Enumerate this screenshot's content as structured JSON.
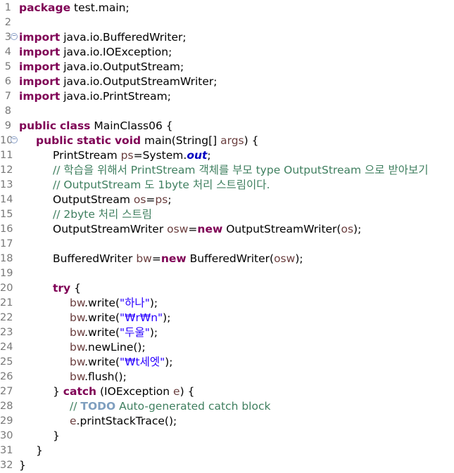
{
  "editor": {
    "language": "java",
    "lines": [
      {
        "n": "1",
        "indent": 0,
        "tokens": [
          {
            "t": "package",
            "c": "kw"
          },
          {
            "t": " test.main;"
          }
        ]
      },
      {
        "n": "2",
        "indent": 0,
        "tokens": []
      },
      {
        "n": "3",
        "indent": 0,
        "fold": true,
        "tokens": [
          {
            "t": "import",
            "c": "kw"
          },
          {
            "t": " java.io.BufferedWriter;"
          }
        ]
      },
      {
        "n": "4",
        "indent": 0,
        "tokens": [
          {
            "t": "import",
            "c": "kw"
          },
          {
            "t": " java.io.IOException;"
          }
        ]
      },
      {
        "n": "5",
        "indent": 0,
        "tokens": [
          {
            "t": "import",
            "c": "kw"
          },
          {
            "t": " java.io.OutputStream;"
          }
        ]
      },
      {
        "n": "6",
        "indent": 0,
        "tokens": [
          {
            "t": "import",
            "c": "kw"
          },
          {
            "t": " java.io.OutputStreamWriter;"
          }
        ]
      },
      {
        "n": "7",
        "indent": 0,
        "tokens": [
          {
            "t": "import",
            "c": "kw"
          },
          {
            "t": " java.io.PrintStream;"
          }
        ]
      },
      {
        "n": "8",
        "indent": 0,
        "tokens": []
      },
      {
        "n": "9",
        "indent": 0,
        "tokens": [
          {
            "t": "public",
            "c": "kw"
          },
          {
            "t": " "
          },
          {
            "t": "class",
            "c": "kw"
          },
          {
            "t": " MainClass06 {"
          }
        ]
      },
      {
        "n": "10",
        "indent": 1,
        "fold": true,
        "tokens": [
          {
            "t": "public",
            "c": "kw"
          },
          {
            "t": " "
          },
          {
            "t": "static",
            "c": "kw"
          },
          {
            "t": " "
          },
          {
            "t": "void",
            "c": "kw"
          },
          {
            "t": " main(String[] "
          },
          {
            "t": "args",
            "c": "var"
          },
          {
            "t": ") {"
          }
        ]
      },
      {
        "n": "11",
        "indent": 2,
        "tokens": [
          {
            "t": "PrintStream "
          },
          {
            "t": "ps",
            "c": "var"
          },
          {
            "t": "=System."
          },
          {
            "t": "out",
            "c": "sf"
          },
          {
            "t": ";"
          }
        ]
      },
      {
        "n": "12",
        "indent": 2,
        "tokens": [
          {
            "t": "// 학습을 위해서 PrintStream 객체를 부모 type OutputStream 으로 받아보기",
            "c": "cm"
          }
        ]
      },
      {
        "n": "13",
        "indent": 2,
        "tokens": [
          {
            "t": "// OutputStream 도 1byte 처리 스트림이다.",
            "c": "cm"
          }
        ]
      },
      {
        "n": "14",
        "indent": 2,
        "tokens": [
          {
            "t": "OutputStream "
          },
          {
            "t": "os",
            "c": "var"
          },
          {
            "t": "="
          },
          {
            "t": "ps",
            "c": "var"
          },
          {
            "t": ";"
          }
        ]
      },
      {
        "n": "15",
        "indent": 2,
        "tokens": [
          {
            "t": "// 2byte 처리 스트림",
            "c": "cm"
          }
        ]
      },
      {
        "n": "16",
        "indent": 2,
        "tokens": [
          {
            "t": "OutputStreamWriter "
          },
          {
            "t": "osw",
            "c": "var"
          },
          {
            "t": "="
          },
          {
            "t": "new",
            "c": "kw"
          },
          {
            "t": " OutputStreamWriter("
          },
          {
            "t": "os",
            "c": "var"
          },
          {
            "t": ");"
          }
        ]
      },
      {
        "n": "17",
        "indent": 0,
        "tokens": []
      },
      {
        "n": "18",
        "indent": 2,
        "tokens": [
          {
            "t": "BufferedWriter "
          },
          {
            "t": "bw",
            "c": "var"
          },
          {
            "t": "="
          },
          {
            "t": "new",
            "c": "kw"
          },
          {
            "t": " BufferedWriter("
          },
          {
            "t": "osw",
            "c": "var"
          },
          {
            "t": ");"
          }
        ]
      },
      {
        "n": "19",
        "indent": 0,
        "tokens": []
      },
      {
        "n": "20",
        "indent": 2,
        "tokens": [
          {
            "t": "try",
            "c": "kw"
          },
          {
            "t": " {"
          }
        ]
      },
      {
        "n": "21",
        "indent": 3,
        "tokens": [
          {
            "t": "bw",
            "c": "var"
          },
          {
            "t": ".write("
          },
          {
            "t": "\"하나\"",
            "c": "str"
          },
          {
            "t": ");"
          }
        ]
      },
      {
        "n": "22",
        "indent": 3,
        "tokens": [
          {
            "t": "bw",
            "c": "var"
          },
          {
            "t": ".write("
          },
          {
            "t": "\"₩r₩n\"",
            "c": "str"
          },
          {
            "t": ");"
          }
        ]
      },
      {
        "n": "23",
        "indent": 3,
        "tokens": [
          {
            "t": "bw",
            "c": "var"
          },
          {
            "t": ".write("
          },
          {
            "t": "\"두울\"",
            "c": "str"
          },
          {
            "t": ");"
          }
        ]
      },
      {
        "n": "24",
        "indent": 3,
        "tokens": [
          {
            "t": "bw",
            "c": "var"
          },
          {
            "t": ".newLine();"
          }
        ]
      },
      {
        "n": "25",
        "indent": 3,
        "tokens": [
          {
            "t": "bw",
            "c": "var"
          },
          {
            "t": ".write("
          },
          {
            "t": "\"₩t세엣\"",
            "c": "str"
          },
          {
            "t": ");"
          }
        ]
      },
      {
        "n": "26",
        "indent": 3,
        "tokens": [
          {
            "t": "bw",
            "c": "var"
          },
          {
            "t": ".flush();"
          }
        ]
      },
      {
        "n": "27",
        "indent": 2,
        "tokens": [
          {
            "t": "} "
          },
          {
            "t": "catch",
            "c": "kw"
          },
          {
            "t": " (IOException "
          },
          {
            "t": "e",
            "c": "var"
          },
          {
            "t": ") {"
          }
        ]
      },
      {
        "n": "28",
        "indent": 3,
        "tokens": [
          {
            "t": "// ",
            "c": "cm"
          },
          {
            "t": "TODO",
            "c": "todo"
          },
          {
            "t": " Auto-generated catch block",
            "c": "cm"
          }
        ]
      },
      {
        "n": "29",
        "indent": 3,
        "tokens": [
          {
            "t": "e",
            "c": "var"
          },
          {
            "t": ".printStackTrace();"
          }
        ]
      },
      {
        "n": "30",
        "indent": 2,
        "tokens": [
          {
            "t": "}"
          }
        ]
      },
      {
        "n": "31",
        "indent": 1,
        "tokens": [
          {
            "t": "}"
          }
        ]
      },
      {
        "n": "32",
        "indent": 0,
        "tokens": [
          {
            "t": "}"
          }
        ]
      }
    ]
  }
}
